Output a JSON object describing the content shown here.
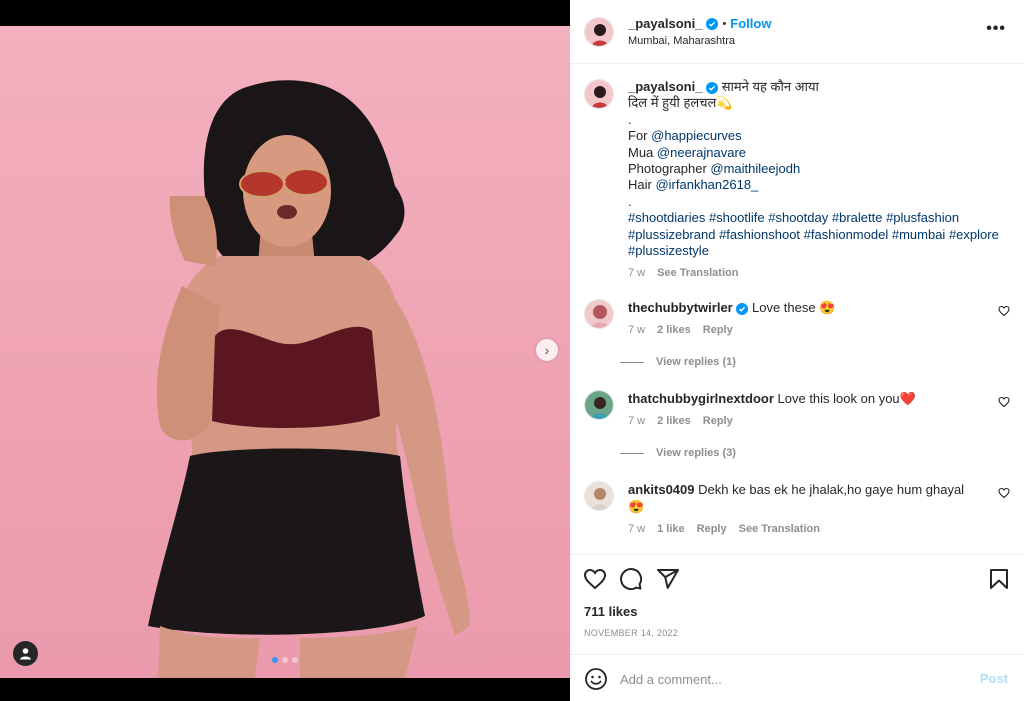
{
  "post": {
    "username": "_payalsoni_",
    "follow_label": "Follow",
    "separator": "•",
    "location": "Mumbai, Maharashtra",
    "more_label": "•••"
  },
  "caption": {
    "username": "_payalsoni_",
    "line1": "सामने यह कौन आया",
    "line2": "दिल में हुयी हलचल💫",
    "dot1": ".",
    "for_label": "For",
    "for_link": "@happiecurves",
    "mua_label": "Mua",
    "mua_link": "@neerajnavare",
    "photographer_label": "Photographer",
    "photographer_link": "@maithileejodh",
    "hair_label": "Hair",
    "hair_link": "@irfankhan2618_",
    "dot2": ".",
    "hashtags": [
      "#shootdiaries",
      "#shootlife",
      "#shootday",
      "#bralette",
      "#plusfashion",
      "#plussizebrand",
      "#fashionshoot",
      "#fashionmodel",
      "#mumbai",
      "#explore",
      "#plussizestyle"
    ],
    "time": "7 w",
    "see_translation": "See Translation"
  },
  "comments": [
    {
      "username": "thechubbytwirler",
      "text": "Love these 😍",
      "time": "7 w",
      "likes": "2 likes",
      "reply": "Reply",
      "view_replies": "View replies (1)"
    },
    {
      "username": "thatchubbygirlnextdoor",
      "text": "Love this look on you❤️",
      "time": "7 w",
      "likes": "2 likes",
      "reply": "Reply",
      "view_replies": "View replies (3)"
    },
    {
      "username": "ankits0409",
      "text": "Dekh ke bas ek he jhalak,ho gaye hum ghayal 😍",
      "time": "7 w",
      "likes": "1 like",
      "reply": "Reply",
      "see_translation": "See Translation"
    }
  ],
  "actions": {
    "likes": "711 likes",
    "date": "NOVEMBER 14, 2022"
  },
  "add_comment": {
    "placeholder": "Add a comment...",
    "post_label": "Post"
  },
  "colors": {
    "accent": "#0095f6",
    "photo_bg": "#efa3b3",
    "post_disabled": "#b2dffc"
  },
  "icons": {
    "like": "heart-icon",
    "comment": "comment-icon",
    "share": "paper-plane-icon",
    "save": "bookmark-icon",
    "emoji": "emoji-icon",
    "tags": "user-tag-icon",
    "next": "chevron-right-icon"
  }
}
